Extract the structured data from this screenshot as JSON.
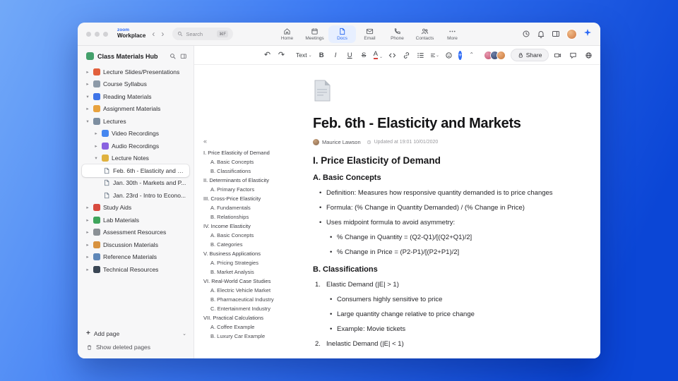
{
  "accent": "#2e6bf6",
  "icons": {
    "back": "‹",
    "forward": "›",
    "collapse_outline": "«",
    "undo": "↶",
    "redo": "↷",
    "dropdown": "⌄",
    "collapse_up": "⌃",
    "plus": "+"
  },
  "titlebar": {
    "brand_top": "zoom",
    "brand_bottom": "Workplace",
    "search": {
      "placeholder": "Search",
      "shortcut": "⌘F"
    },
    "tabs": [
      {
        "label": "Home",
        "icon": "home-icon"
      },
      {
        "label": "Meetings",
        "icon": "calendar-icon"
      },
      {
        "label": "Docs",
        "icon": "doc-icon",
        "active": true
      },
      {
        "label": "Email",
        "icon": "mail-icon"
      },
      {
        "label": "Phone",
        "icon": "phone-icon"
      },
      {
        "label": "Contacts",
        "icon": "contacts-icon"
      },
      {
        "label": "More",
        "icon": "more-dots-icon"
      }
    ]
  },
  "sidebar": {
    "title": "Class Materials Hub",
    "items": [
      {
        "label": "Lecture Slides/Presentations",
        "chevron": "▸",
        "icon": "presentation-icon",
        "level": 0
      },
      {
        "label": "Course Syllabus",
        "chevron": "▸",
        "icon": "syllabus-icon",
        "level": 0
      },
      {
        "label": "Reading Materials",
        "chevron": "▾",
        "icon": "book-icon",
        "level": 0
      },
      {
        "label": "Assignment Materials",
        "chevron": "▸",
        "icon": "assignment-icon",
        "level": 0
      },
      {
        "label": "Lectures",
        "chevron": "▾",
        "icon": "lectures-icon",
        "level": 0
      },
      {
        "label": "Video Recordings",
        "chevron": "▸",
        "icon": "video-icon",
        "level": 1
      },
      {
        "label": "Audio Recordings",
        "chevron": "▸",
        "icon": "audio-icon",
        "level": 1
      },
      {
        "label": "Lecture Notes",
        "chevron": "▾",
        "icon": "notes-icon",
        "level": 1
      },
      {
        "label": "Feb. 6th - Elasticity and M...",
        "chevron": "",
        "icon": "doc-page-icon",
        "level": 2,
        "selected": true
      },
      {
        "label": "Jan. 30th - Markets and P...",
        "chevron": "",
        "icon": "doc-page-icon",
        "level": 2
      },
      {
        "label": "Jan. 23rd - Intro to Econo...",
        "chevron": "",
        "icon": "doc-page-icon",
        "level": 2
      },
      {
        "label": "Study Aids",
        "chevron": "▸",
        "icon": "study-aids-icon",
        "level": 0
      },
      {
        "label": "Lab Materials",
        "chevron": "▸",
        "icon": "lab-icon",
        "level": 0
      },
      {
        "label": "Assessment Resources",
        "chevron": "▸",
        "icon": "assessment-icon",
        "level": 0
      },
      {
        "label": "Discussion Materials",
        "chevron": "▸",
        "icon": "discussion-icon",
        "level": 0
      },
      {
        "label": "Reference Materials",
        "chevron": "▸",
        "icon": "reference-icon",
        "level": 0
      },
      {
        "label": "Technical Resources",
        "chevron": "▸",
        "icon": "technical-icon",
        "level": 0
      }
    ],
    "add_page": "Add page",
    "show_deleted": "Show deleted pages"
  },
  "toolbar": {
    "text_style": "Text",
    "bold": "B",
    "italic": "I",
    "underline": "U",
    "strike": "S",
    "color": "A",
    "share_label": "Share"
  },
  "toc": {
    "items": [
      {
        "label": "I. Price Elasticity of Demand",
        "level": 0
      },
      {
        "label": "A. Basic Concepts",
        "level": 1
      },
      {
        "label": "B. Classifications",
        "level": 1
      },
      {
        "label": "II. Determinants of Elasticity",
        "level": 0
      },
      {
        "label": "A. Primary Factors",
        "level": 1
      },
      {
        "label": "III. Cross-Price Elasticity",
        "level": 0
      },
      {
        "label": "A. Fundamentals",
        "level": 1
      },
      {
        "label": "B. Relationships",
        "level": 1
      },
      {
        "label": "IV. Income Elasticity",
        "level": 0
      },
      {
        "label": "A. Basic Concepts",
        "level": 1
      },
      {
        "label": "B. Categories",
        "level": 1
      },
      {
        "label": "V. Business Applications",
        "level": 0
      },
      {
        "label": "A. Pricing Strategies",
        "level": 1
      },
      {
        "label": "B. Market Analysis",
        "level": 1
      },
      {
        "label": "VI. Real-World Case Studies",
        "level": 0
      },
      {
        "label": "A. Electric Vehicle Market",
        "level": 1
      },
      {
        "label": "B. Pharmaceutical Industry",
        "level": 1
      },
      {
        "label": "C. Entertainment Industry",
        "level": 1
      },
      {
        "label": "VII. Practical Calculations",
        "level": 0
      },
      {
        "label": "A. Coffee Example",
        "level": 1
      },
      {
        "label": "B. Luxury Car Example",
        "level": 1
      }
    ]
  },
  "doc": {
    "title": "Feb. 6th - Elasticity and Markets",
    "author": "Maurice Lawson",
    "updated": "Updated at 19:01 10/01/2020",
    "blocks": [
      {
        "type": "h2",
        "text": "I. Price Elasticity of Demand"
      },
      {
        "type": "h3",
        "text": "A. Basic Concepts"
      },
      {
        "type": "bullet1",
        "text": "Definition: Measures how responsive quantity demanded is to price changes"
      },
      {
        "type": "bullet1",
        "text": "Formula: (% Change in Quantity Demanded) / (% Change in Price)"
      },
      {
        "type": "bullet1",
        "text": "Uses midpoint formula to avoid asymmetry:"
      },
      {
        "type": "bullet2",
        "text": "% Change in Quantity = (Q2-Q1)/[(Q2+Q1)/2]"
      },
      {
        "type": "bullet2",
        "text": "% Change in Price = (P2-P1)/[(P2+P1)/2]"
      },
      {
        "type": "h3",
        "text": "B. Classifications"
      },
      {
        "type": "numbered",
        "num": "1.",
        "text": "Elastic Demand (|E| > 1)"
      },
      {
        "type": "bullet2",
        "text": "Consumers highly sensitive to price"
      },
      {
        "type": "bullet2",
        "text": "Large quantity change relative to price change"
      },
      {
        "type": "bullet2",
        "text": "Example: Movie tickets"
      },
      {
        "type": "numbered",
        "num": "2.",
        "text": "Inelastic Demand (|E| < 1)"
      }
    ]
  }
}
